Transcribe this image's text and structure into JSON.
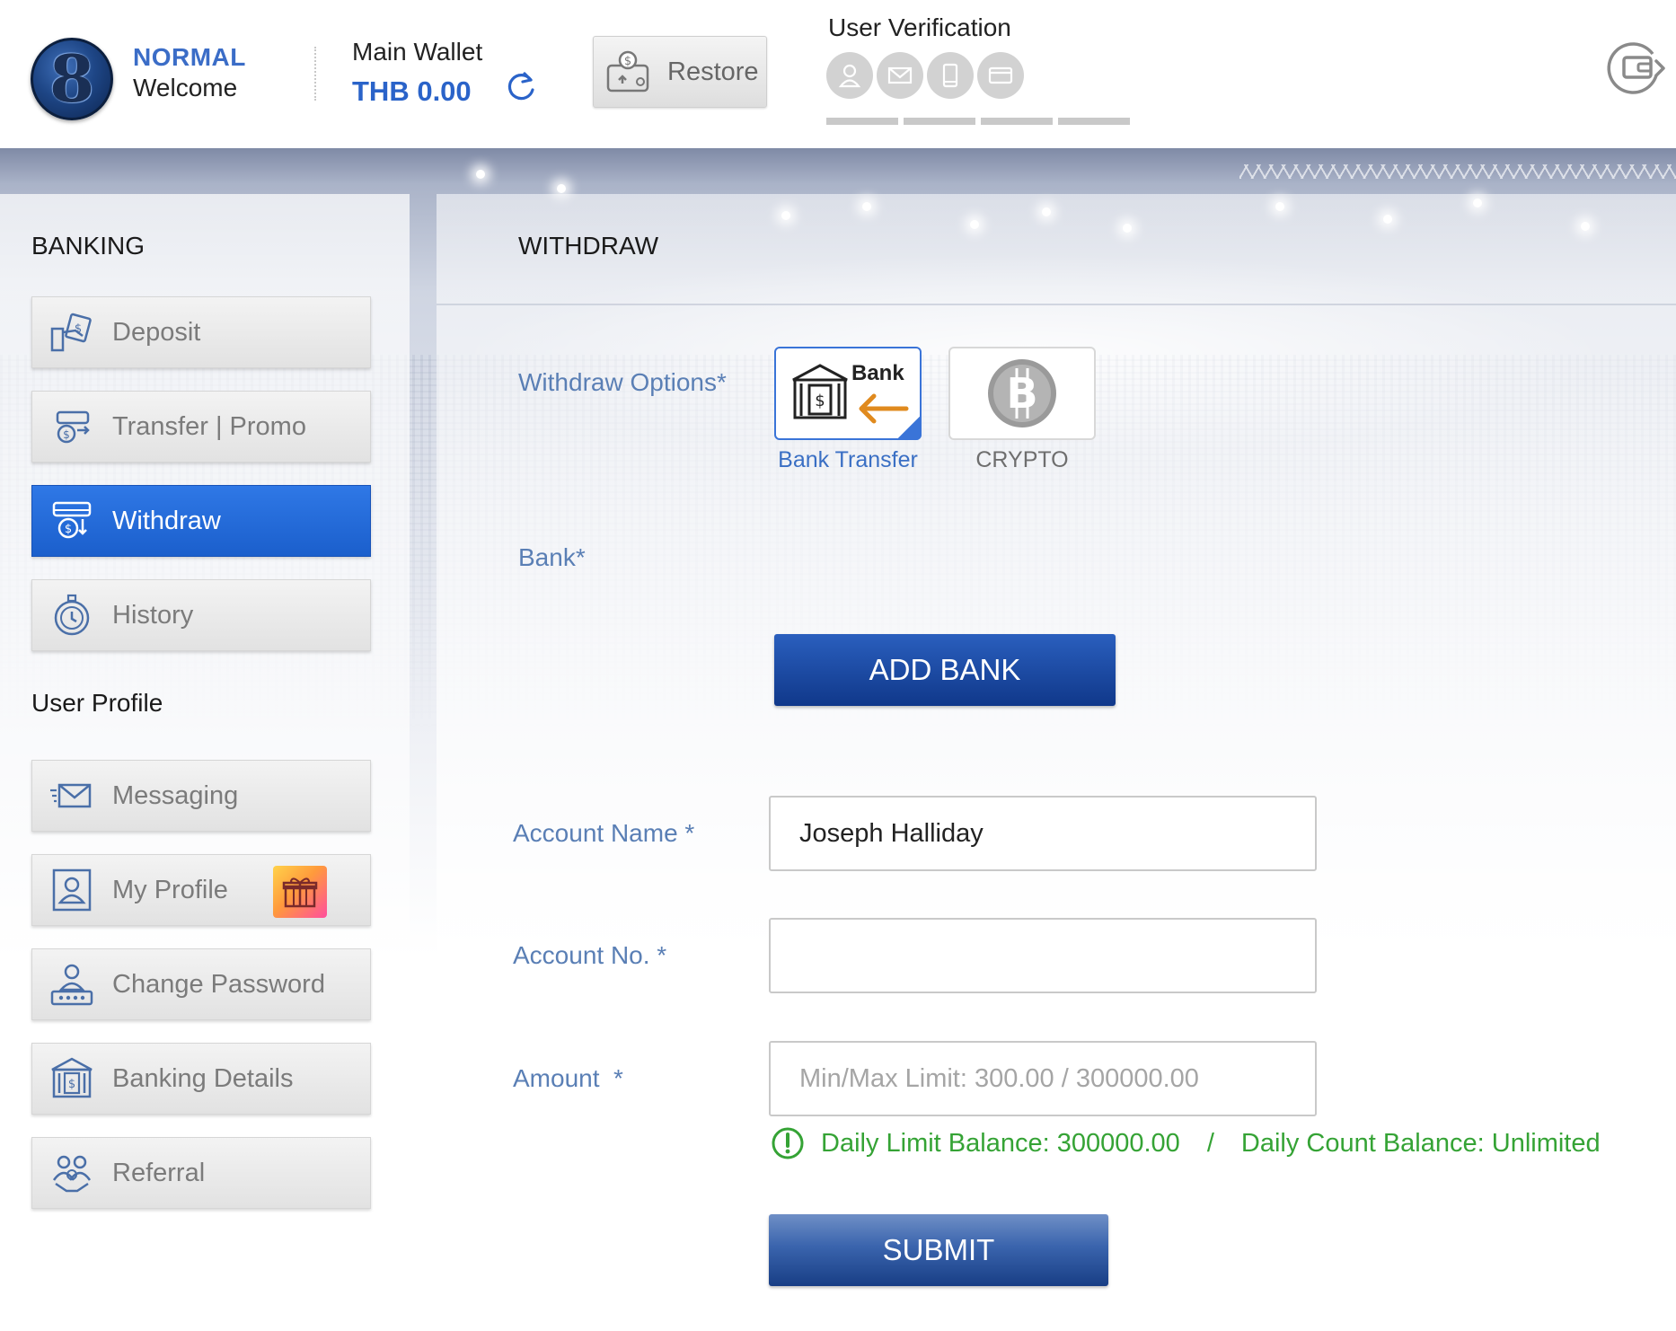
{
  "header": {
    "tier": "NORMAL",
    "welcome": "Welcome",
    "wallet_label": "Main Wallet",
    "wallet_amount": "THB 0.00",
    "restore_label": "Restore",
    "verification_title": "User Verification",
    "verification_icons": [
      "user-icon",
      "mail-icon",
      "phone-icon",
      "card-icon"
    ],
    "verification_progress": [
      0,
      0,
      0,
      0
    ]
  },
  "sidebar": {
    "banking_title": "BANKING",
    "banking_items": [
      {
        "label": "Deposit",
        "icon": "deposit-icon"
      },
      {
        "label": "Transfer | Promo",
        "icon": "transfer-icon"
      },
      {
        "label": "Withdraw",
        "icon": "withdraw-icon",
        "active": true
      },
      {
        "label": "History",
        "icon": "history-icon"
      }
    ],
    "profile_title": "User Profile",
    "profile_items": [
      {
        "label": "Messaging",
        "icon": "messaging-icon"
      },
      {
        "label": "My Profile",
        "icon": "profile-icon",
        "badge": "gift-icon"
      },
      {
        "label": "Change Password",
        "icon": "password-icon"
      },
      {
        "label": "Banking Details",
        "icon": "bank-icon"
      },
      {
        "label": "Referral",
        "icon": "referral-icon"
      }
    ]
  },
  "main": {
    "title": "WITHDRAW",
    "withdraw_options_label": "Withdraw Options*",
    "options": [
      {
        "label": "Bank Transfer",
        "card_text": "Bank",
        "selected": true
      },
      {
        "label": "CRYPTO",
        "selected": false
      }
    ],
    "bank_label": "Bank*",
    "add_bank_label": "ADD BANK",
    "account_name_label": "Account Name *",
    "account_name_value": "Joseph Halliday",
    "account_no_label": "Account No. *",
    "account_no_value": "",
    "amount_label": "Amount  *",
    "amount_placeholder": "Min/Max Limit: 300.00 / 300000.00",
    "daily_limit": "Daily Limit Balance: 300000.00",
    "limit_separator": "/",
    "daily_count": "Daily Count Balance: Unlimited",
    "submit_label": "SUBMIT"
  },
  "colors": {
    "accent": "#2a63c9",
    "active_nav": "#1b5fcc",
    "label_blue": "#5a7fb5",
    "success_green": "#35a335"
  }
}
